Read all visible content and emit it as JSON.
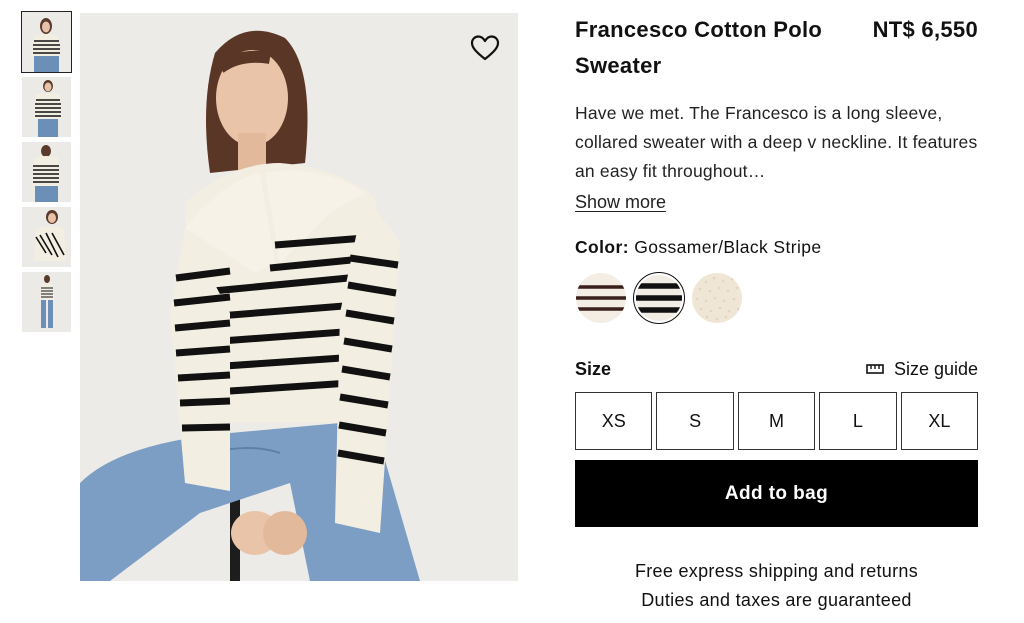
{
  "product": {
    "title": "Francesco Cotton Polo Sweater",
    "price": "NT$ 6,550",
    "description": "Have we met. The Francesco is a long sleeve, collared sweater with a deep v neckline. It features an easy fit throughout…",
    "show_more": "Show more"
  },
  "gallery": {
    "thumbnails": [
      "thumb-1",
      "thumb-2",
      "thumb-3",
      "thumb-4",
      "thumb-5"
    ],
    "active_index": 0,
    "wishlist_icon": "heart-icon"
  },
  "color": {
    "label": "Color:",
    "selected": "Gossamer/Black Stripe",
    "swatches": [
      {
        "name": "cream-brown-stripe",
        "colors": [
          "#f3ede4",
          "#3b1f1a"
        ]
      },
      {
        "name": "gossamer-black-stripe",
        "colors": [
          "#f1ede4",
          "#111111"
        ]
      },
      {
        "name": "solid-cream-knit",
        "colors": [
          "#efe6d6"
        ]
      }
    ]
  },
  "size": {
    "label": "Size",
    "guide_label": "Size guide",
    "guide_icon": "ruler-icon",
    "options": [
      "XS",
      "S",
      "M",
      "L",
      "XL"
    ]
  },
  "actions": {
    "add_to_bag": "Add to bag"
  },
  "shipping": {
    "line1": "Free express shipping and returns",
    "line2": "Duties and taxes are guaranteed"
  }
}
